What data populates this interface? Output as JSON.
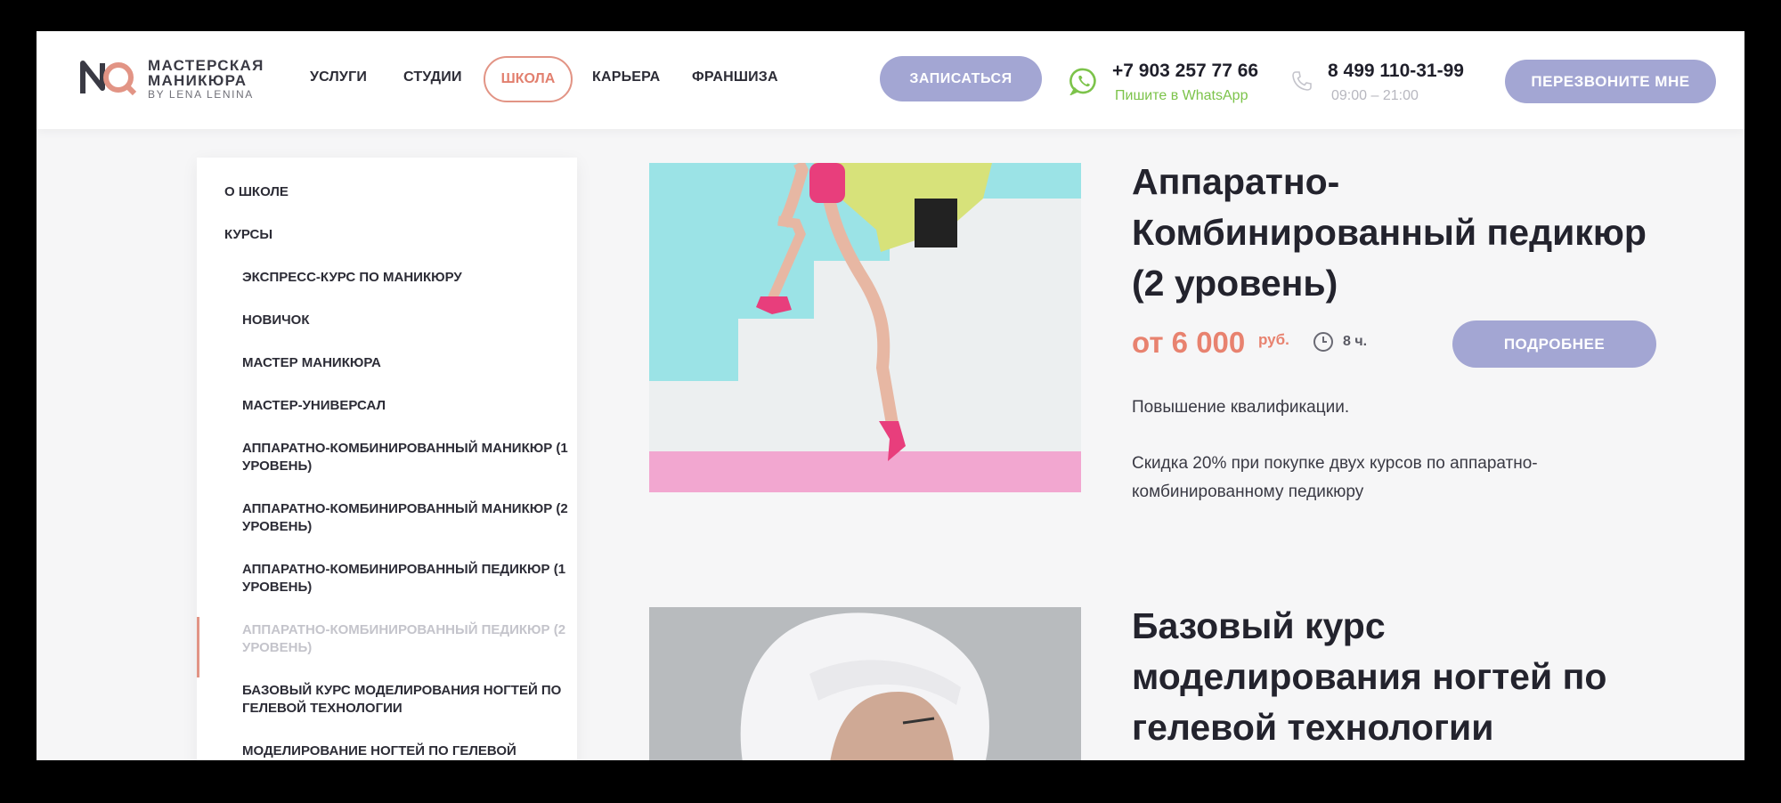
{
  "logo": {
    "line1": "МАСТЕРСКАЯ",
    "line2": "МАНИКЮРА",
    "line3": "BY LENA LENINA"
  },
  "nav": {
    "services": "УСЛУГИ",
    "studios": "СТУДИИ",
    "school": "ШКОЛА",
    "career": "КАРЬЕРА",
    "franchise": "ФРАНШИЗА"
  },
  "header": {
    "signup_label": "ЗАПИСАТЬСЯ",
    "phone_whatsapp": "+7 903 257 77 66",
    "whatsapp_text": "Пишите в WhatsApp",
    "phone_main": "8 499 110-31-99",
    "hours": "09:00 – 21:00",
    "callback_label": "ПЕРЕЗВОНИТЕ МНЕ"
  },
  "sidebar": {
    "about": "О ШКОЛЕ",
    "courses": "КУРСЫ",
    "items": [
      "ЭКСПРЕСС-КУРС ПО МАНИКЮРУ",
      "НОВИЧОК",
      "МАСТЕР МАНИКЮРА",
      "МАСТЕР-УНИВЕРСАЛ",
      "АППАРАТНО-КОМБИНИРОВАННЫЙ МАНИКЮР (1 УРОВЕНЬ)",
      "АППАРАТНО-КОМБИНИРОВАННЫЙ МАНИКЮР (2 УРОВЕНЬ)",
      "АППАРАТНО-КОМБИНИРОВАННЫЙ ПЕДИКЮР (1 УРОВЕНЬ)",
      "АППАРАТНО-КОМБИНИРОВАННЫЙ ПЕДИКЮР (2 УРОВЕНЬ)",
      "БАЗОВЫЙ КУРС МОДЕЛИРОВАНИЯ НОГТЕЙ ПО ГЕЛЕВОЙ ТЕХНОЛОГИИ",
      "МОДЕЛИРОВАНИЕ НОГТЕЙ ПО ГЕЛЕВОЙ"
    ]
  },
  "courses": [
    {
      "title": "Аппаратно-Комбинированный педикюр (2 уровень)",
      "price": "от 6 000",
      "price_unit": "руб.",
      "duration": "8 ч.",
      "details_label": "ПОДРОБНЕЕ",
      "desc1": "Повышение квалификации.",
      "desc2": "Скидка 20% при покупке двух курсов по аппаратно-комбинированному педикюру"
    },
    {
      "title": "Базовый курс моделирования ногтей по гелевой технологии"
    }
  ],
  "colors": {
    "accent": "#e29485",
    "button": "#a3a6d3",
    "whatsapp": "#7cc34a",
    "text": "#23232d"
  }
}
